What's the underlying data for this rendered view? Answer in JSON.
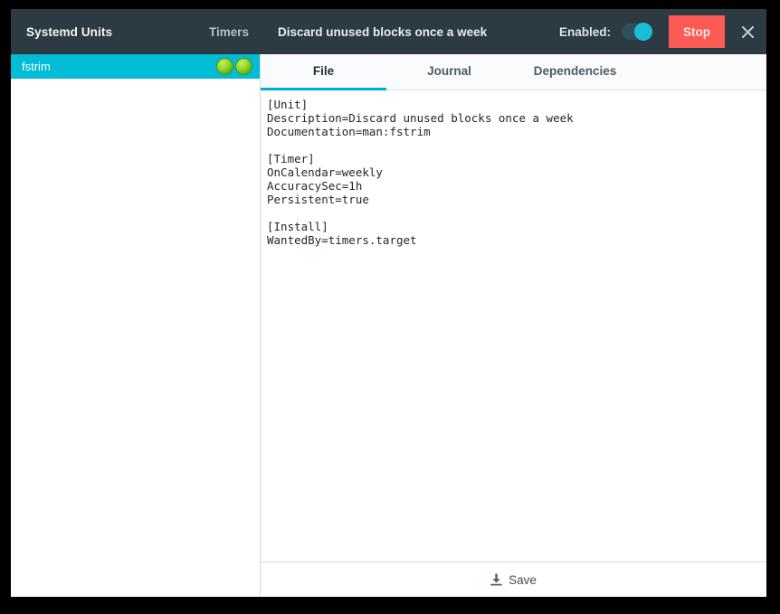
{
  "window": {
    "app_title": "Systemd Units",
    "unit_kind": "Timers"
  },
  "header": {
    "unit_description": "Discard unused blocks once a week",
    "enabled_label": "Enabled:",
    "toggle_state": "on",
    "stop_label": "Stop",
    "close_icon": "close-icon",
    "toggle_accent": "#17bed4",
    "stop_color": "#fb5b54",
    "bar_color": "#2c3a42"
  },
  "sidebar": {
    "units": [
      {
        "name": "fstrim",
        "selected": true,
        "indicators": [
          "active-led",
          "enabled-led"
        ]
      }
    ],
    "selection_color": "#00bcd4",
    "led_color": "#92d72c"
  },
  "tabs": [
    {
      "label": "File",
      "active": true
    },
    {
      "label": "Journal",
      "active": false
    },
    {
      "label": "Dependencies",
      "active": false
    }
  ],
  "tab_accent": "#00b0cc",
  "file": {
    "content": "[Unit]\nDescription=Discard unused blocks once a week\nDocumentation=man:fstrim\n\n[Timer]\nOnCalendar=weekly\nAccuracySec=1h\nPersistent=true\n\n[Install]\nWantedBy=timers.target"
  },
  "footer": {
    "save_label": "Save",
    "save_icon": "save-download-icon"
  }
}
